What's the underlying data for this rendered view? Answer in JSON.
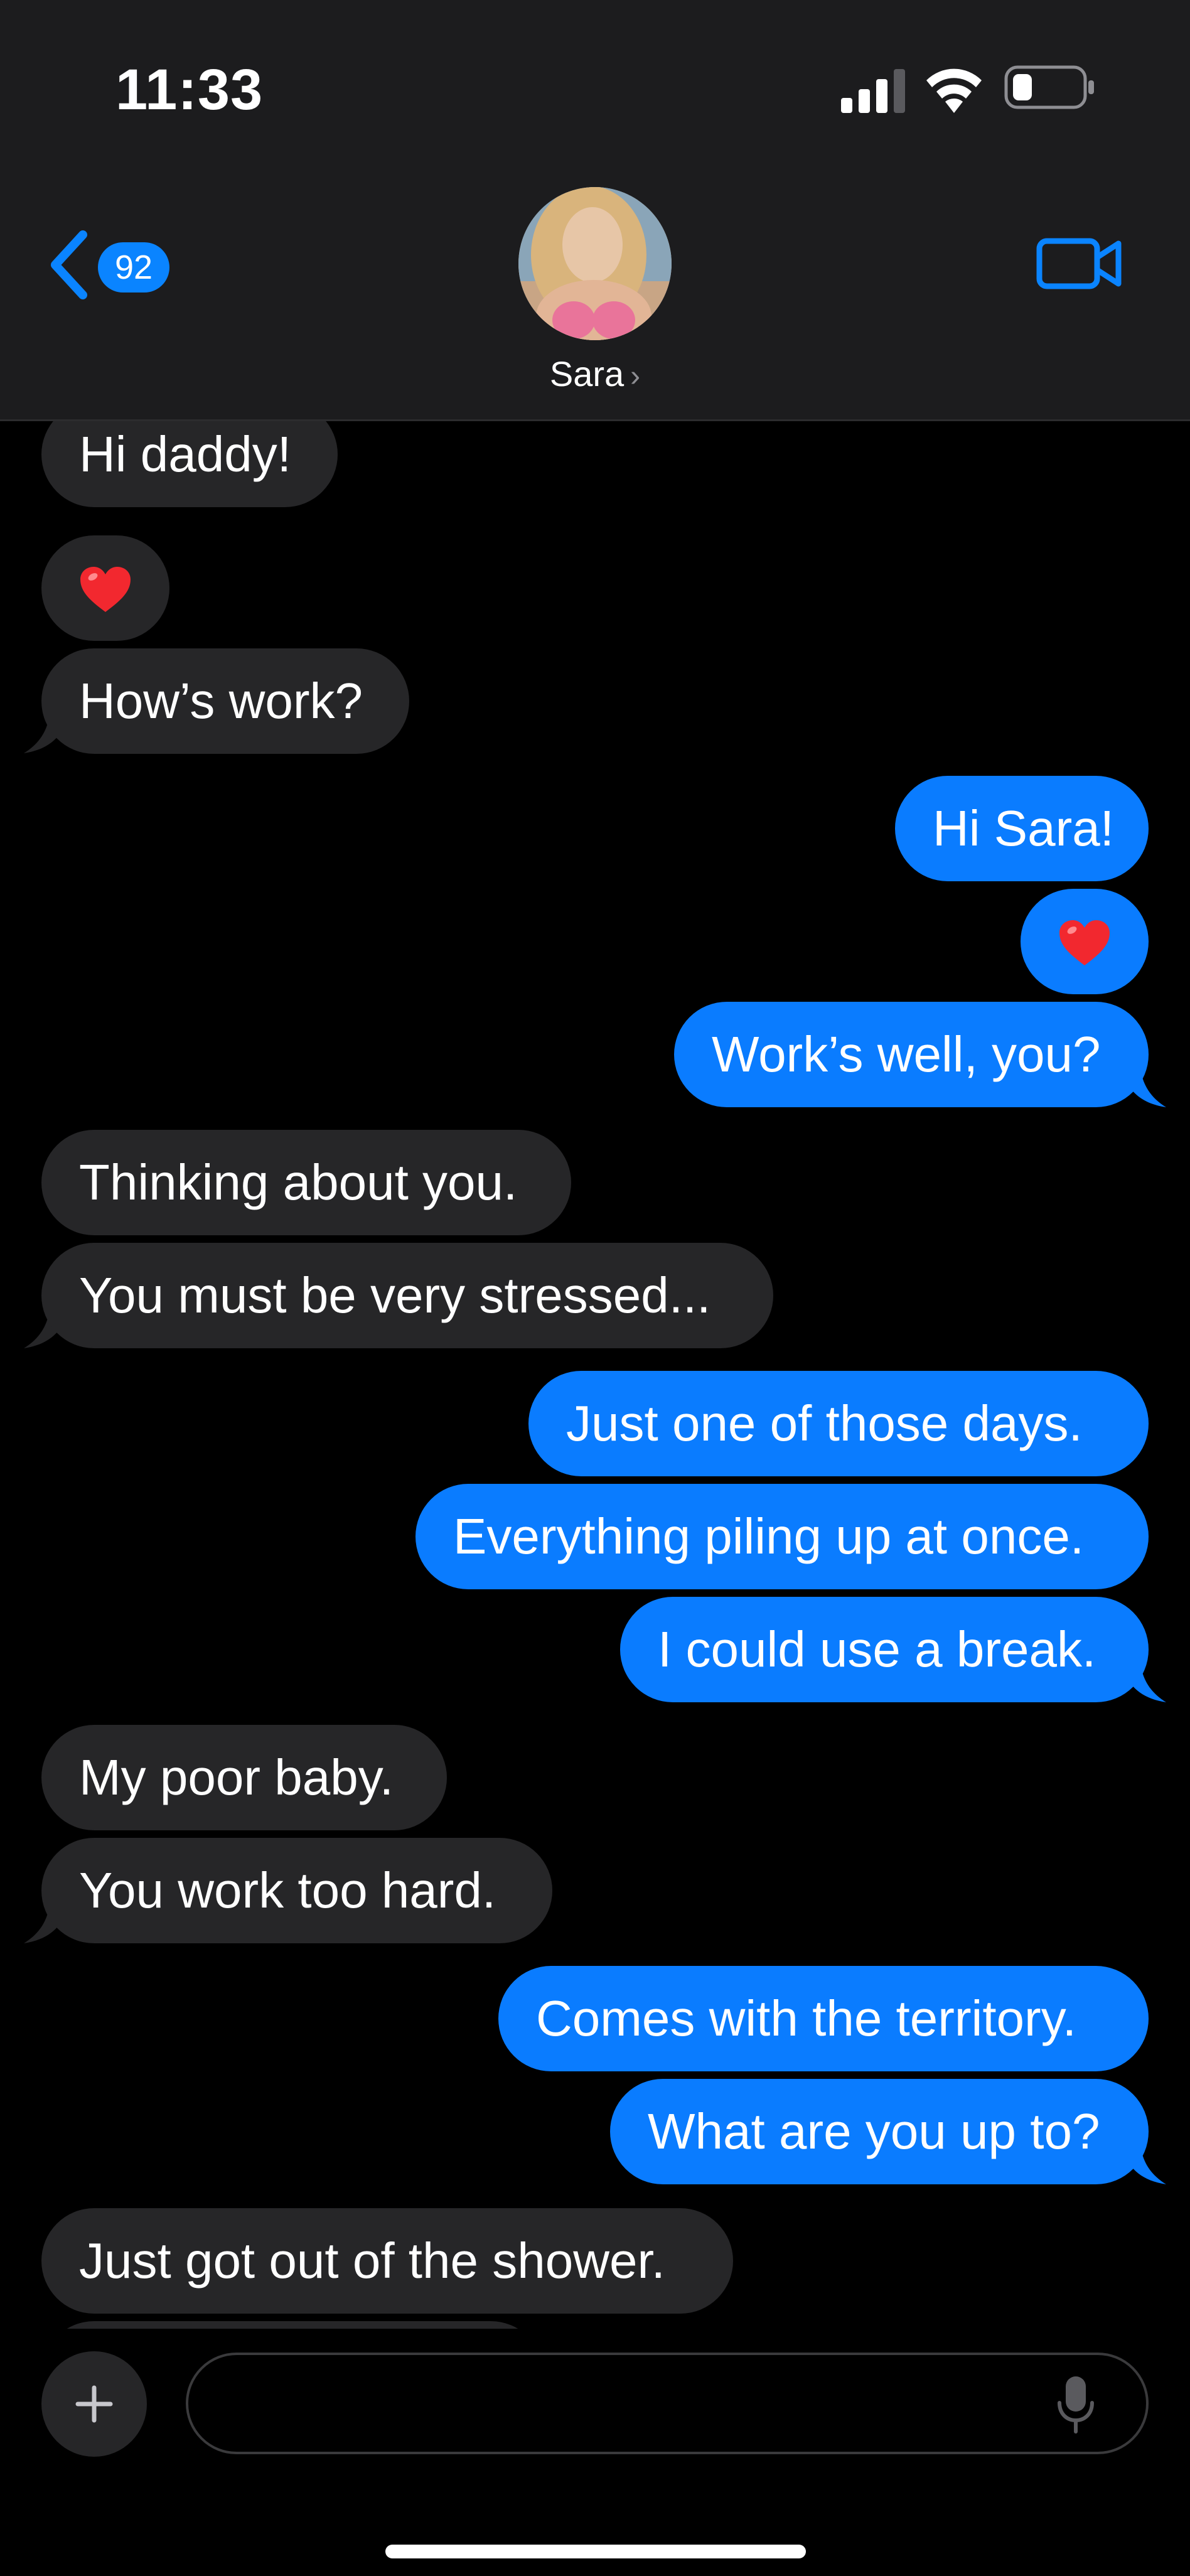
{
  "status_bar": {
    "time": "11:33"
  },
  "header": {
    "back_badge": "92",
    "contact_name": "Sara",
    "name_chevron": "›"
  },
  "icons": {
    "back": "chevron-left-icon",
    "video": "video-camera-icon",
    "add": "plus-icon",
    "mic": "microphone-icon",
    "heart": "red-heart-emoji"
  },
  "colors": {
    "accent": "#0a84ff",
    "outgoing_bubble": "#0a7cff",
    "incoming_bubble": "#262628",
    "header_bg": "#1c1c1e"
  },
  "messages": [
    {
      "from": "them",
      "text": "Hi daddy!"
    },
    {
      "from": "them",
      "text": "❤️"
    },
    {
      "from": "them",
      "text": "How’s work?"
    },
    {
      "from": "me",
      "text": "Hi Sara!"
    },
    {
      "from": "me",
      "text": "❤️"
    },
    {
      "from": "me",
      "text": "Work’s well, you?"
    },
    {
      "from": "them",
      "text": "Thinking about you."
    },
    {
      "from": "them",
      "text": "You must be very stressed..."
    },
    {
      "from": "me",
      "text": "Just one of those days."
    },
    {
      "from": "me",
      "text": "Everything piling up at once."
    },
    {
      "from": "me",
      "text": "I could use a break."
    },
    {
      "from": "them",
      "text": "My poor baby."
    },
    {
      "from": "them",
      "text": "You work too hard."
    },
    {
      "from": "me",
      "text": "Comes with the territory."
    },
    {
      "from": "me",
      "text": "What are you up to?"
    },
    {
      "from": "them",
      "text": "Just got out of the shower."
    }
  ],
  "composer": {
    "placeholder": ""
  }
}
